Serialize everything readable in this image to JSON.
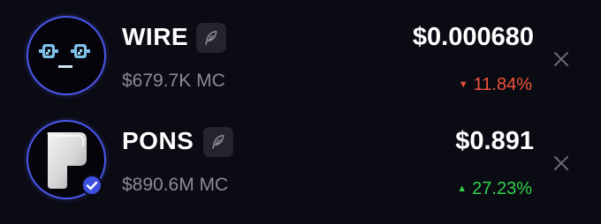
{
  "colors": {
    "background": "#0b0b13",
    "positive": "#2fd34c",
    "negative": "#f0533a",
    "muted_text": "#8a8a94",
    "avatar_ring": "#4a56e8",
    "verified_badge": "#3d4fe0"
  },
  "tokens": [
    {
      "ticker": "WIRE",
      "market_cap": "$679.7K MC",
      "price": "$0.000680",
      "change": "11.84%",
      "direction": "down",
      "avatar_icon": "pixel-face-avatar-icon",
      "source_icon": "feather-icon",
      "verified": false
    },
    {
      "ticker": "PONS",
      "market_cap": "$890.6M MC",
      "price": "$0.891",
      "change": "27.23%",
      "direction": "up",
      "avatar_icon": "letter-p-avatar-icon",
      "source_icon": "feather-icon",
      "verified": true
    }
  ]
}
